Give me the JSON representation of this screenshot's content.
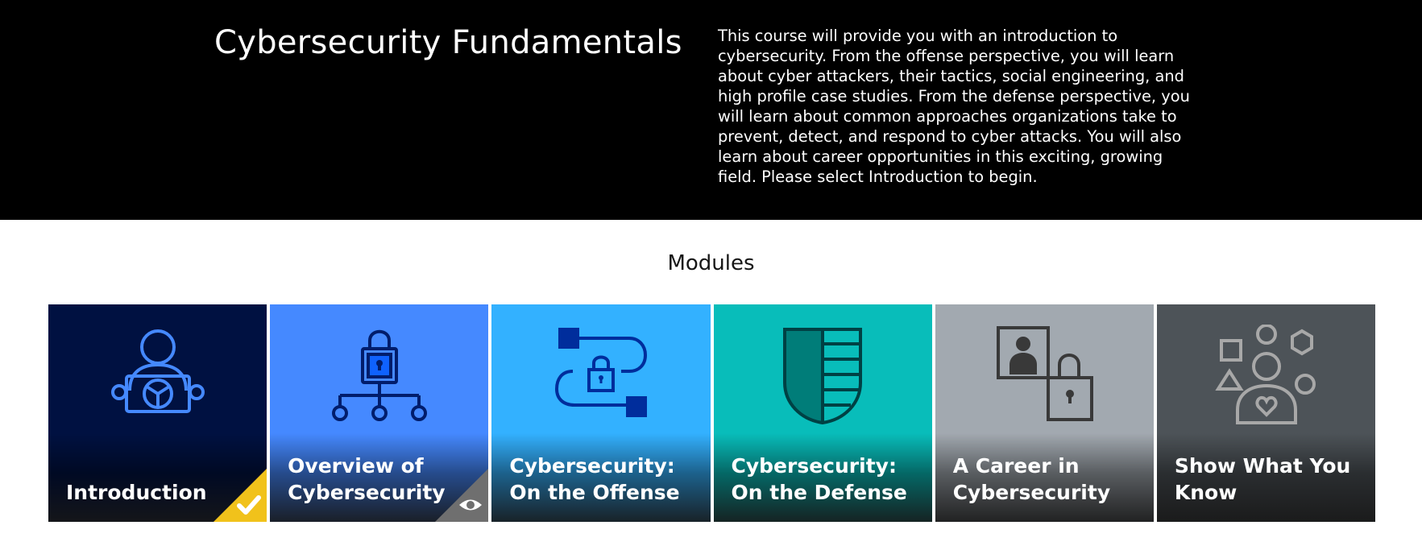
{
  "header": {
    "title": "Cybersecurity Fundamentals",
    "description": "This course will provide you with an introduction to cybersecurity. From the offense perspective, you will learn about cyber attackers, their tactics, social engineering, and high profile case studies. From the defense perspective, you will learn about common approaches organizations take to prevent, detect, and respond to cyber attacks. You will also learn about career opportunities in this exciting, growing field. Please select Introduction to begin."
  },
  "modules": {
    "heading": "Modules",
    "items": [
      {
        "title_lines": [
          "Introduction"
        ],
        "icon": "person-holding-sign-icon",
        "status": "completed",
        "status_icon": "checkmark-icon",
        "bg": "#001141",
        "icon_color": "#4589ff"
      },
      {
        "title_lines": [
          "Overview of",
          "Cybersecurity"
        ],
        "icon": "lock-network-icon",
        "status": "viewed",
        "status_icon": "eye-icon",
        "bg": "#4589ff",
        "icon_color": "#001d6c"
      },
      {
        "title_lines": [
          "Cybersecurity:",
          "On the Offense"
        ],
        "icon": "lock-path-icon",
        "status": "",
        "bg": "#33b1ff",
        "icon_color": "#002d9c"
      },
      {
        "title_lines": [
          "Cybersecurity:",
          "On the Defense"
        ],
        "icon": "shield-icon",
        "status": "",
        "bg": "#08bdba",
        "icon_color": "#004144"
      },
      {
        "title_lines": [
          "A Career in",
          "Cybersecurity"
        ],
        "icon": "person-lock-icon",
        "status": "",
        "bg": "#a2a9b0",
        "icon_color": "#393939"
      },
      {
        "title_lines": [
          "Show What You",
          "Know"
        ],
        "icon": "person-shapes-icon",
        "status": "",
        "bg": "#4d5358",
        "icon_color": "#a8a8a8"
      }
    ]
  },
  "colors": {
    "banner": "#000000",
    "completed_badge": "#f1c21b",
    "viewed_badge": "#6f6f6f"
  }
}
